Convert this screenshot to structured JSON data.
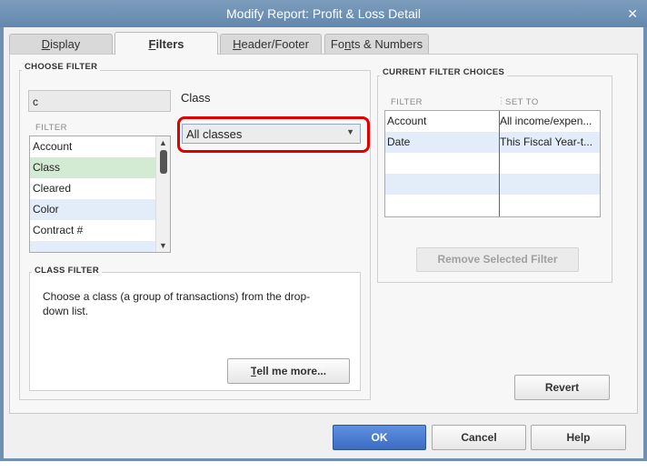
{
  "window": {
    "title": "Modify Report: Profit & Loss Detail",
    "close": "✕"
  },
  "tabs": [
    {
      "label": "Display",
      "u": "D",
      "rest": "isplay"
    },
    {
      "label": "Filters",
      "u": "F",
      "rest": "ilters"
    },
    {
      "label": "Header/Footer",
      "u": "H",
      "rest": "eader/Footer"
    },
    {
      "label": "Fonts & Numbers",
      "pre": "Fo",
      "u": "n",
      "rest": "ts & Numbers"
    }
  ],
  "choose_filter": {
    "title": "CHOOSE FILTER",
    "search_value": "c",
    "list_header": "FILTER",
    "items": [
      "Account",
      "Class",
      "Cleared",
      "Color",
      "Contract #"
    ],
    "selected": "Class"
  },
  "class_field": {
    "label": "Class",
    "value": "All classes"
  },
  "class_filter": {
    "title": "CLASS FILTER",
    "description": "Choose a class (a group of transactions) from the drop-down list.",
    "tell_more": "Tell me more..."
  },
  "current": {
    "title": "CURRENT FILTER CHOICES",
    "col_filter": "FILTER",
    "col_set": "SET TO",
    "rows": [
      {
        "filter": "Account",
        "set": "All income/expen..."
      },
      {
        "filter": "Date",
        "set": "This Fiscal Year-t..."
      }
    ],
    "remove": "Remove Selected Filter"
  },
  "buttons": {
    "revert": "Revert",
    "ok": "OK",
    "cancel": "Cancel",
    "help": "Help"
  },
  "colors": {
    "selected_row": "#d3ead3",
    "alt_row": "#e3edfa",
    "highlight": "#e00000",
    "ok": "#4a7bd0"
  }
}
